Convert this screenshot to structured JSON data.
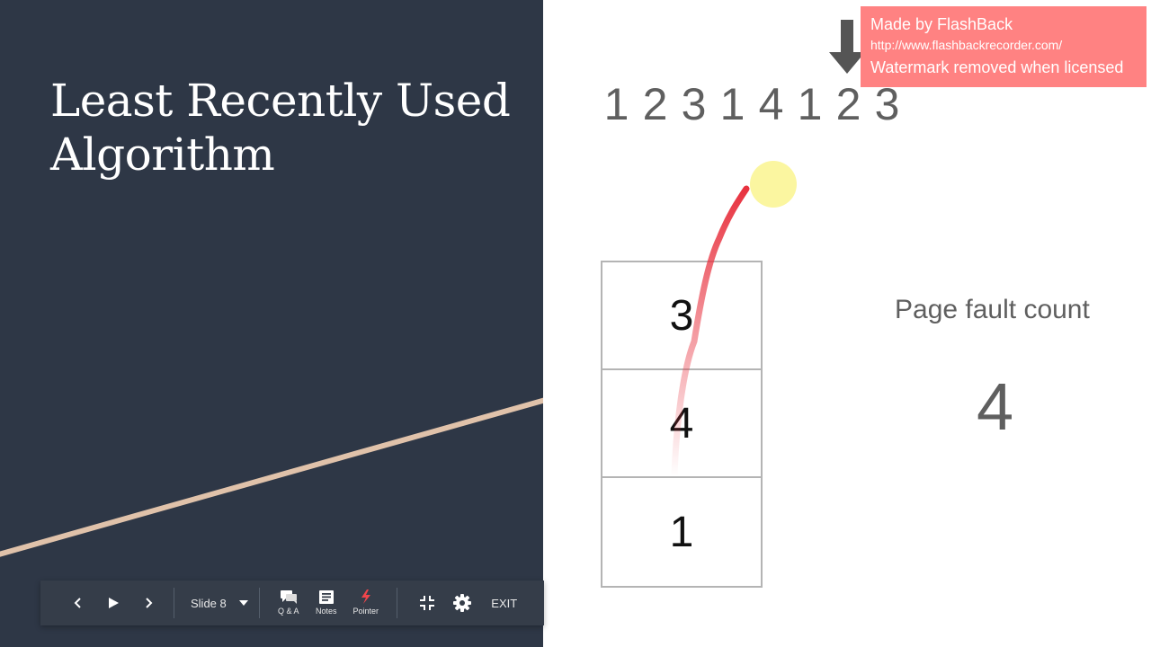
{
  "slide": {
    "title_line1": "Least Recently Used",
    "title_line2": "Algorithm"
  },
  "reference_string": [
    "1",
    "2",
    "3",
    "1",
    "4",
    "1",
    "2",
    "3"
  ],
  "current_index": 6,
  "frames": [
    "3",
    "4",
    "1"
  ],
  "page_fault": {
    "label": "Page fault count",
    "value": "4"
  },
  "watermark": {
    "line1": "Made by FlashBack",
    "line2": "http://www.flashbackrecorder.com/",
    "line3": "Watermark removed when licensed",
    "bg_color": "#ff8282"
  },
  "toolbar": {
    "prev_icon": "chevron-left-icon",
    "play_icon": "play-icon",
    "next_icon": "chevron-right-icon",
    "slide_label": "Slide 8",
    "qa_label": "Q & A",
    "notes_label": "Notes",
    "pointer_label": "Pointer",
    "exit_label": "EXIT"
  },
  "colors": {
    "left_bg": "#2e3746",
    "stripe": "#e0c2aa",
    "pointer_dot": "#fbf6a0",
    "ink": "#e8323f"
  }
}
